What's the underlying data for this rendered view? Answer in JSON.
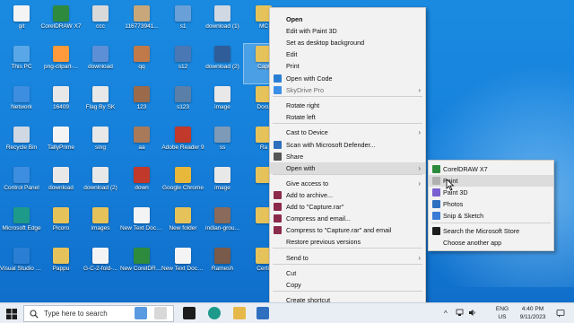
{
  "desktop_icons": [
    {
      "label": "git",
      "color": "#f4f4f4"
    },
    {
      "label": "CorelDRAW X7",
      "color": "#2e8b3e"
    },
    {
      "label": "ccc",
      "color": "#d9d9d9"
    },
    {
      "label": "116773941...",
      "color": "#c8a77a"
    },
    {
      "label": "s1",
      "color": "#6aa0d8"
    },
    {
      "label": "download (1)",
      "color": "#cfd8e3"
    },
    {
      "label": "MC",
      "color": "#e6c35a"
    },
    {
      "label": "This PC",
      "color": "#5aa7e8"
    },
    {
      "label": "png-clipart-...",
      "color": "#ff9a3c"
    },
    {
      "label": "download",
      "color": "#5d8fd6"
    },
    {
      "label": "qq",
      "color": "#c07a4a"
    },
    {
      "label": "s12",
      "color": "#4a78b5"
    },
    {
      "label": "download (2)",
      "color": "#2f5d9a"
    },
    {
      "label": "Capt",
      "color": "#e6c35a"
    },
    {
      "label": "Network",
      "color": "#3d8ee0"
    },
    {
      "label": "16409",
      "color": "#e8e8e8"
    },
    {
      "label": "Flag By SK",
      "color": "#e8e8e8"
    },
    {
      "label": "123",
      "color": "#9a6a4a"
    },
    {
      "label": "s123",
      "color": "#5a7fa8"
    },
    {
      "label": "image",
      "color": "#e8e8e8"
    },
    {
      "label": "Docu",
      "color": "#e6c35a"
    },
    {
      "label": "Recycle Bin",
      "color": "#cfd8e3"
    },
    {
      "label": "TallyPrime",
      "color": "#f4f4f4"
    },
    {
      "label": "sing",
      "color": "#e8e8e8"
    },
    {
      "label": "aa",
      "color": "#a87a5a"
    },
    {
      "label": "Adobe Reader 9",
      "color": "#c0392b"
    },
    {
      "label": "ss",
      "color": "#7d9ab8"
    },
    {
      "label": "Ra",
      "color": "#e6c35a"
    },
    {
      "label": "Control Panel",
      "color": "#3d8ee0"
    },
    {
      "label": "download",
      "color": "#e8e8e8"
    },
    {
      "label": "download (2)",
      "color": "#e8e8e8"
    },
    {
      "label": "down",
      "color": "#c0392b"
    },
    {
      "label": "Google Chrome",
      "color": "#e8b83a"
    },
    {
      "label": "image",
      "color": "#e8e8e8"
    },
    {
      "label": "",
      "color": "#e6c35a"
    },
    {
      "label": "Microsoft Edge",
      "color": "#1e9a8a"
    },
    {
      "label": "Picoro",
      "color": "#e6c35a"
    },
    {
      "label": "images",
      "color": "#e6c35a"
    },
    {
      "label": "New Text Document",
      "color": "#f4f4f4"
    },
    {
      "label": "New folder",
      "color": "#e6c35a"
    },
    {
      "label": "indian-grou...",
      "color": "#8a6a5a"
    },
    {
      "label": "",
      "color": "#e6c35a"
    },
    {
      "label": "Visual Studio Code",
      "color": "#2a7fd4"
    },
    {
      "label": "Pappu",
      "color": "#e6c35a"
    },
    {
      "label": "G-C-2-fold-...",
      "color": "#f4f4f4"
    },
    {
      "label": "New CorelDRAW...",
      "color": "#2e8b3e"
    },
    {
      "label": "New Text Document (2)",
      "color": "#f4f4f4"
    },
    {
      "label": "Ramesh",
      "color": "#7a5a4a"
    },
    {
      "label": "Certif",
      "color": "#e6c35a"
    }
  ],
  "context_menu": {
    "items": [
      {
        "label": "Open",
        "bold": true
      },
      {
        "label": "Edit with Paint 3D"
      },
      {
        "label": "Set as desktop background"
      },
      {
        "label": "Edit"
      },
      {
        "label": "Print"
      },
      {
        "label": "Open with Code",
        "icon": "vscode-icon"
      },
      {
        "label": "SkyDrive Pro",
        "disabled": true,
        "arrow": true,
        "icon": "skydrive-icon"
      },
      {
        "label": "Rotate right"
      },
      {
        "label": "Rotate left"
      },
      {
        "label": "Cast to Device",
        "arrow": true
      },
      {
        "label": "Scan with Microsoft Defender...",
        "icon": "defender-icon"
      },
      {
        "label": "Share",
        "icon": "share-icon"
      },
      {
        "label": "Open with",
        "arrow": true,
        "hover": true
      },
      {
        "label": "Give access to",
        "arrow": true
      },
      {
        "label": "Add to archive...",
        "icon": "winrar-icon"
      },
      {
        "label": "Add to \"Capture.rar\"",
        "icon": "winrar-icon"
      },
      {
        "label": "Compress and email...",
        "icon": "winrar-icon"
      },
      {
        "label": "Compress to \"Capture.rar\" and email",
        "icon": "winrar-icon"
      },
      {
        "label": "Restore previous versions"
      },
      {
        "label": "Send to",
        "arrow": true
      },
      {
        "label": "Cut"
      },
      {
        "label": "Copy"
      },
      {
        "label": "Create shortcut"
      }
    ],
    "more_arrow": "▾"
  },
  "open_with_submenu": {
    "items": [
      {
        "label": "CorelDRAW X7",
        "icon": "coreldraw-icon"
      },
      {
        "label": "Paint",
        "icon": "paint-icon",
        "hover": true
      },
      {
        "label": "Paint 3D",
        "icon": "paint3d-icon"
      },
      {
        "label": "Photos",
        "icon": "photos-icon"
      },
      {
        "label": "Snip & Sketch",
        "icon": "snip-icon"
      },
      {
        "label": "Search the Microsoft Store",
        "icon": "store-icon"
      },
      {
        "label": "Choose another app"
      }
    ]
  },
  "taskbar": {
    "search_placeholder": "Type here to search",
    "lang_line1": "ENG",
    "lang_line2": "US",
    "time": "4:40 PM",
    "date": "9/11/2023"
  },
  "colors": {
    "desktop": "#1681dc",
    "menu_bg": "#f2f2f2",
    "taskbar": "#e9eef4"
  }
}
